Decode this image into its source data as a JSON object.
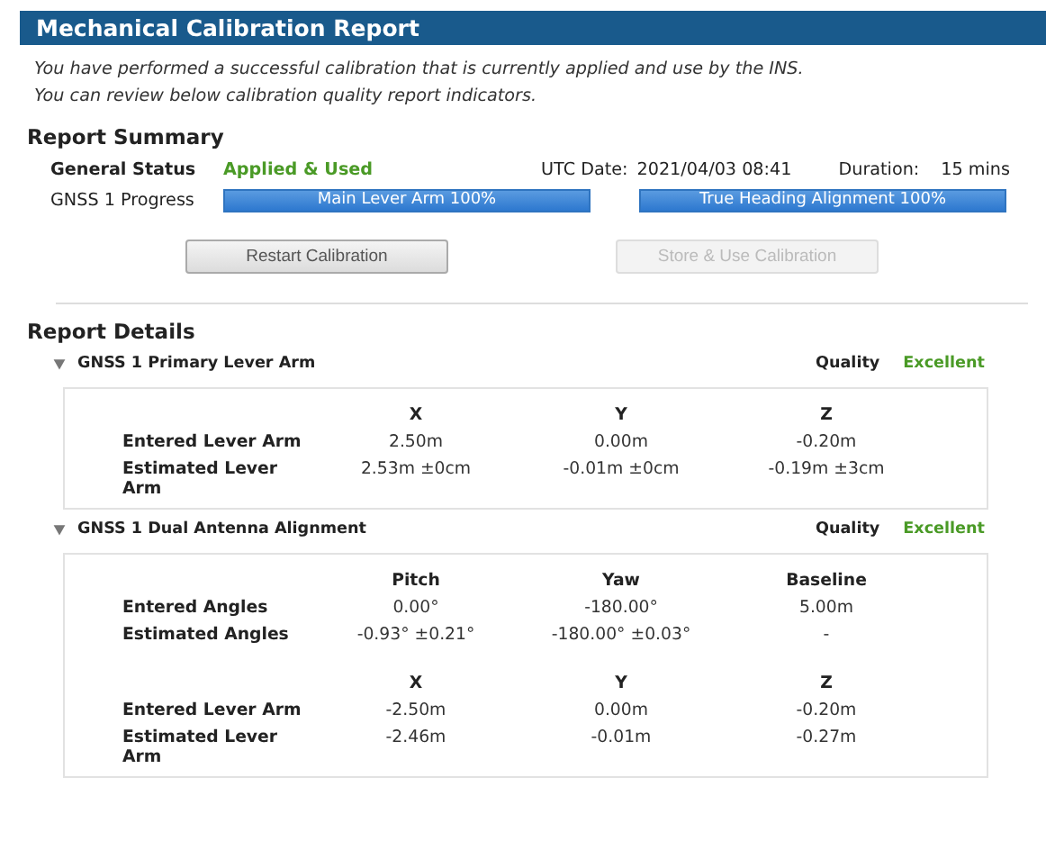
{
  "title": "Mechanical Calibration Report",
  "intro": [
    "You have performed a successful calibration that is currently applied and use by the INS.",
    "You can review below calibration quality report indicators."
  ],
  "summary": {
    "heading": "Report Summary",
    "status_label": "General Status",
    "status_value": "Applied & Used",
    "date_label": "UTC Date:",
    "date_value": "2021/04/03 08:41",
    "duration_label": "Duration:",
    "duration_value": "15 mins",
    "progress_label": "GNSS 1 Progress",
    "progress": [
      {
        "label": "Main Lever Arm 100%",
        "level": 1
      },
      {
        "label": "True Heading Alignment 100%",
        "level": 1
      }
    ]
  },
  "buttons": [
    {
      "label": "Restart Calibration",
      "disabled": false
    },
    {
      "label": "Store & Use Calibration",
      "disabled": true
    }
  ],
  "details_heading": "Report Details",
  "sections": [
    {
      "title": "GNSS 1 Primary Lever Arm",
      "expanded": true,
      "quality_label": "Quality",
      "quality": "Excellent",
      "blocks": [
        {
          "columns": [
            "X",
            "Y",
            "Z"
          ],
          "rows": [
            {
              "label": "Entered Lever Arm",
              "cells": [
                "2.50m",
                "0.00m",
                "-0.20m"
              ]
            },
            {
              "label": "Estimated Lever Arm",
              "cells": [
                "2.53m ±0cm",
                "-0.01m ±0cm",
                "-0.19m ±3cm"
              ]
            }
          ]
        }
      ]
    },
    {
      "title": "GNSS 1 Dual Antenna Alignment",
      "expanded": true,
      "quality_label": "Quality",
      "quality": "Excellent",
      "blocks": [
        {
          "columns": [
            "Pitch",
            "Yaw",
            "Baseline"
          ],
          "rows": [
            {
              "label": "Entered Angles",
              "cells": [
                "0.00°",
                "-180.00°",
                "5.00m"
              ]
            },
            {
              "label": "Estimated Angles",
              "cells": [
                "-0.93° ±0.21°",
                "-180.00° ±0.03°",
                "-"
              ]
            }
          ]
        },
        {
          "columns": [
            "X",
            "Y",
            "Z"
          ],
          "rows": [
            {
              "label": "Entered Lever Arm",
              "cells": [
                "-2.50m",
                "0.00m",
                "-0.20m"
              ]
            },
            {
              "label": "Estimated Lever Arm",
              "cells": [
                "-2.46m",
                "-0.01m",
                "-0.27m"
              ]
            }
          ]
        }
      ]
    }
  ]
}
